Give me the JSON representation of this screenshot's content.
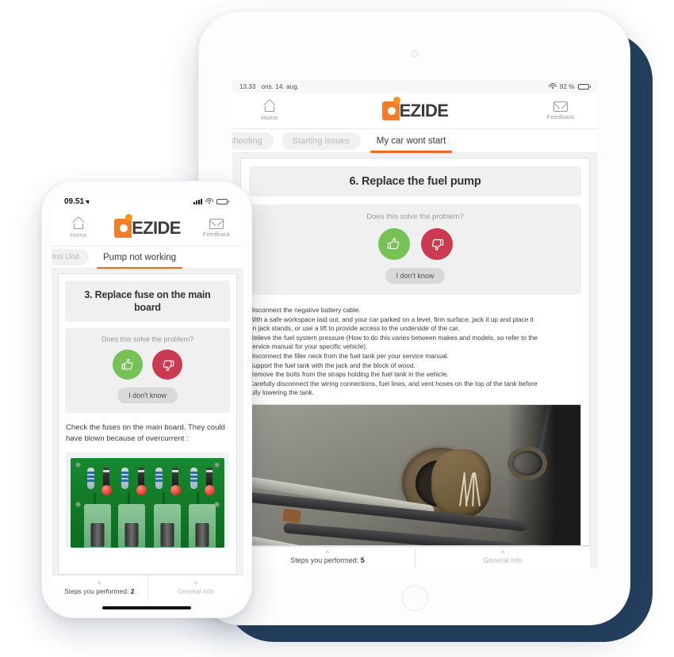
{
  "brand": {
    "name": "DEZIDE",
    "accent": "#F07D28",
    "accent_dot": "#F7941D",
    "tab_underline": "#F26522"
  },
  "colors": {
    "thumbs_up": "#77C255",
    "thumbs_down": "#CC3A52",
    "backdrop_navy": "#24405E"
  },
  "tablet": {
    "status_bar": {
      "time": "13.33",
      "date": "ons. 14. aug.",
      "battery": "92 %",
      "wifi_icon": "wifi-icon",
      "battery_icon": "battery-icon"
    },
    "header": {
      "home_label": "Home",
      "home_icon": "home-icon",
      "feedback_label": "Feedback",
      "feedback_icon": "mail-icon",
      "logo_text": "EZIDE"
    },
    "tabs": [
      {
        "label": "shooting",
        "state": "inactive-clipped"
      },
      {
        "label": "Starting issues",
        "state": "inactive"
      },
      {
        "label": "My car wont start",
        "state": "active"
      }
    ],
    "card": {
      "title": "6. Replace the fuel pump",
      "question": "Does this solve the problem?",
      "thumbs_up_icon": "thumbs-up-icon",
      "thumbs_down_icon": "thumbs-down-icon",
      "dont_know_label": "I don't know"
    },
    "steps": [
      "Disconnect the negative battery cable.",
      "With a safe workspace laid out, and your car parked on a level, firm surface, jack it up and place it",
      "on jack stands, or use a lift to provide access to the underside of the car.",
      "Relieve the fuel system pressure (How to do this varies between makes and models, so refer to the",
      "service manual for your specific vehicle).",
      "Disconnect the filler neck from the fuel tank per your service manual.",
      "Support the fuel tank with the jack and the block of wood.",
      "Remove the bolts from the straps holding the fuel tank in the vehicle.",
      "Carefully disconnect the wiring connections, fuel lines, and vent hoses on the top of the tank before",
      "fully lowering the tank."
    ],
    "photo_name": "fuel-tank-photo",
    "bottom_bar": {
      "steps_label": "Steps you performed:",
      "steps_count": "5",
      "general_info_label": "General info",
      "chevron_icon": "chevron-up-icon"
    }
  },
  "phone": {
    "status_bar": {
      "time": "09.51",
      "location_icon": "location-arrow-icon",
      "signal_icon": "signal-bars-icon",
      "wifi_icon": "wifi-icon",
      "battery_icon": "battery-icon"
    },
    "header": {
      "home_label": "Home",
      "home_icon": "home-icon",
      "feedback_label": "Feedback",
      "feedback_icon": "mail-icon",
      "logo_text": "EZIDE"
    },
    "tabs": [
      {
        "label": "ntrol Unit",
        "state": "inactive-clipped"
      },
      {
        "label": "Pump not working",
        "state": "active"
      }
    ],
    "card": {
      "title": "3. Replace fuse on the main board",
      "question": "Does this solve the problem?",
      "thumbs_up_icon": "thumbs-up-icon",
      "thumbs_down_icon": "thumbs-down-icon",
      "dont_know_label": "I don't know"
    },
    "body_text": "Check the fuses on the main board. They could have blown because of overcurrent :",
    "photo_name": "fuse-board-photo",
    "bottom_bar": {
      "steps_label": "Steps you performed:",
      "steps_count": "2",
      "general_info_label": "General info",
      "chevron_icon": "chevron-up-icon"
    }
  }
}
